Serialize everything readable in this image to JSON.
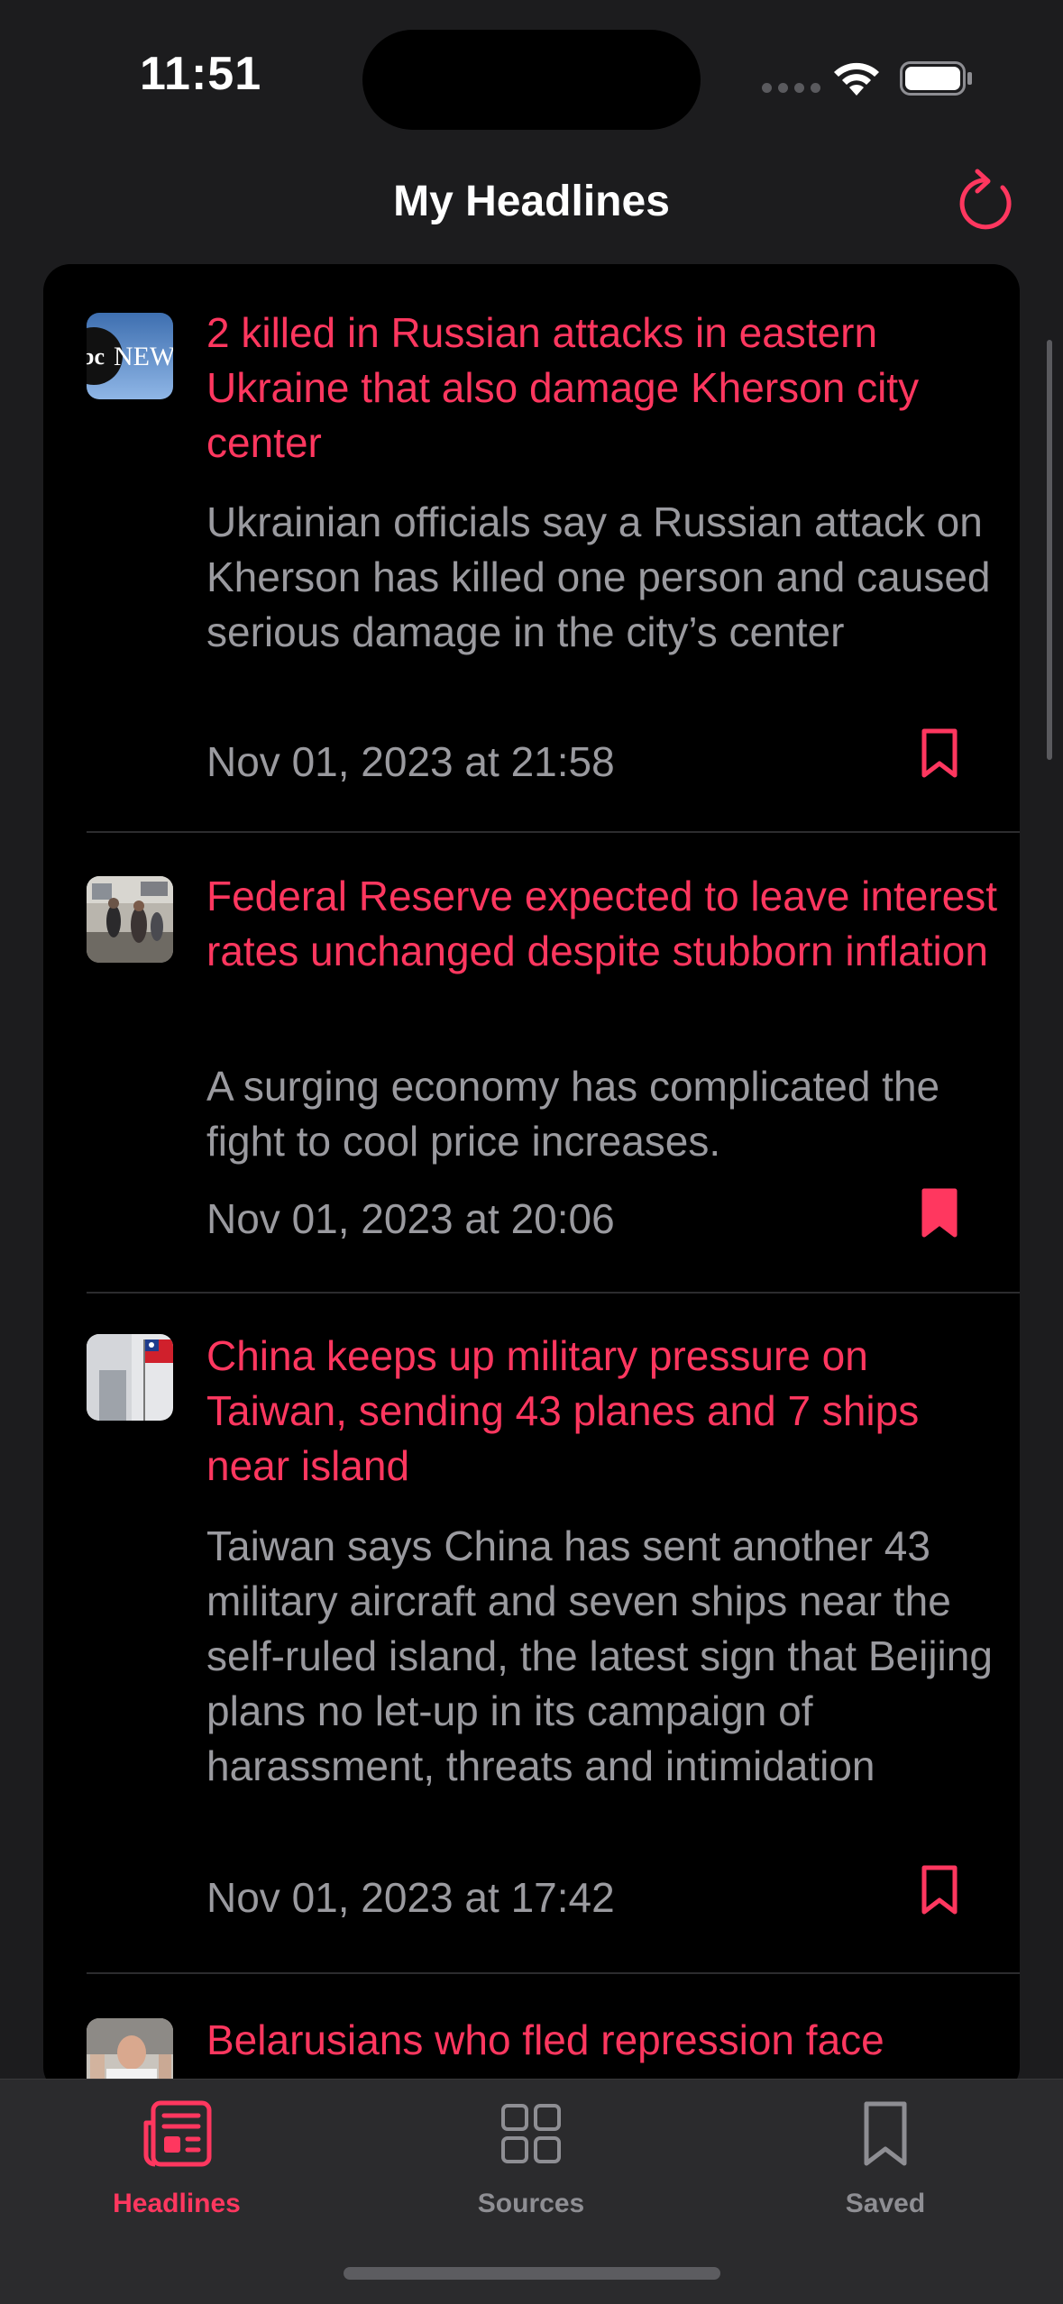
{
  "status_bar": {
    "time": "11:51"
  },
  "nav": {
    "title": "My Headlines",
    "refresh_icon": "refresh-icon"
  },
  "articles": [
    {
      "source_thumb": "abc-news-logo",
      "title": "2 killed in Russian attacks in eastern Ukraine that also damage Kherson city center",
      "description": "Ukrainian officials say a Russian attack on Kherson has killed one person and caused serious damage in the city’s center",
      "date": "Nov 01, 2023 at 21:58",
      "saved": false
    },
    {
      "source_thumb": "news-photo",
      "title": "Federal Reserve expected to leave interest rates unchanged despite stubborn inflation",
      "description": "A surging economy has complicated the fight to cool price increases.",
      "date": "Nov 01, 2023 at 20:06",
      "saved": true
    },
    {
      "source_thumb": "news-photo",
      "title": "China keeps up military pressure on Taiwan, sending 43 planes and 7 ships near island",
      "description": "Taiwan says China has sent another 43 military aircraft and seven ships near the self-ruled island, the latest sign that Beijing plans no let-up in its campaign of harassment, threats and intimidation",
      "date": "Nov 01, 2023 at 17:42",
      "saved": false
    },
    {
      "source_thumb": "news-photo",
      "title": "Belarusians who fled repression face",
      "description": "",
      "date": "",
      "saved": false
    }
  ],
  "tabs": [
    {
      "label": "Headlines",
      "icon": "newspaper-icon",
      "active": true
    },
    {
      "label": "Sources",
      "icon": "grid-icon",
      "active": false
    },
    {
      "label": "Saved",
      "icon": "bookmark-icon",
      "active": false
    }
  ],
  "colors": {
    "accent": "#ff375f",
    "secondary_text": "#9a9a9f",
    "background": "#1c1c1e",
    "card": "#000000",
    "tabbar": "#2b2b2d"
  }
}
